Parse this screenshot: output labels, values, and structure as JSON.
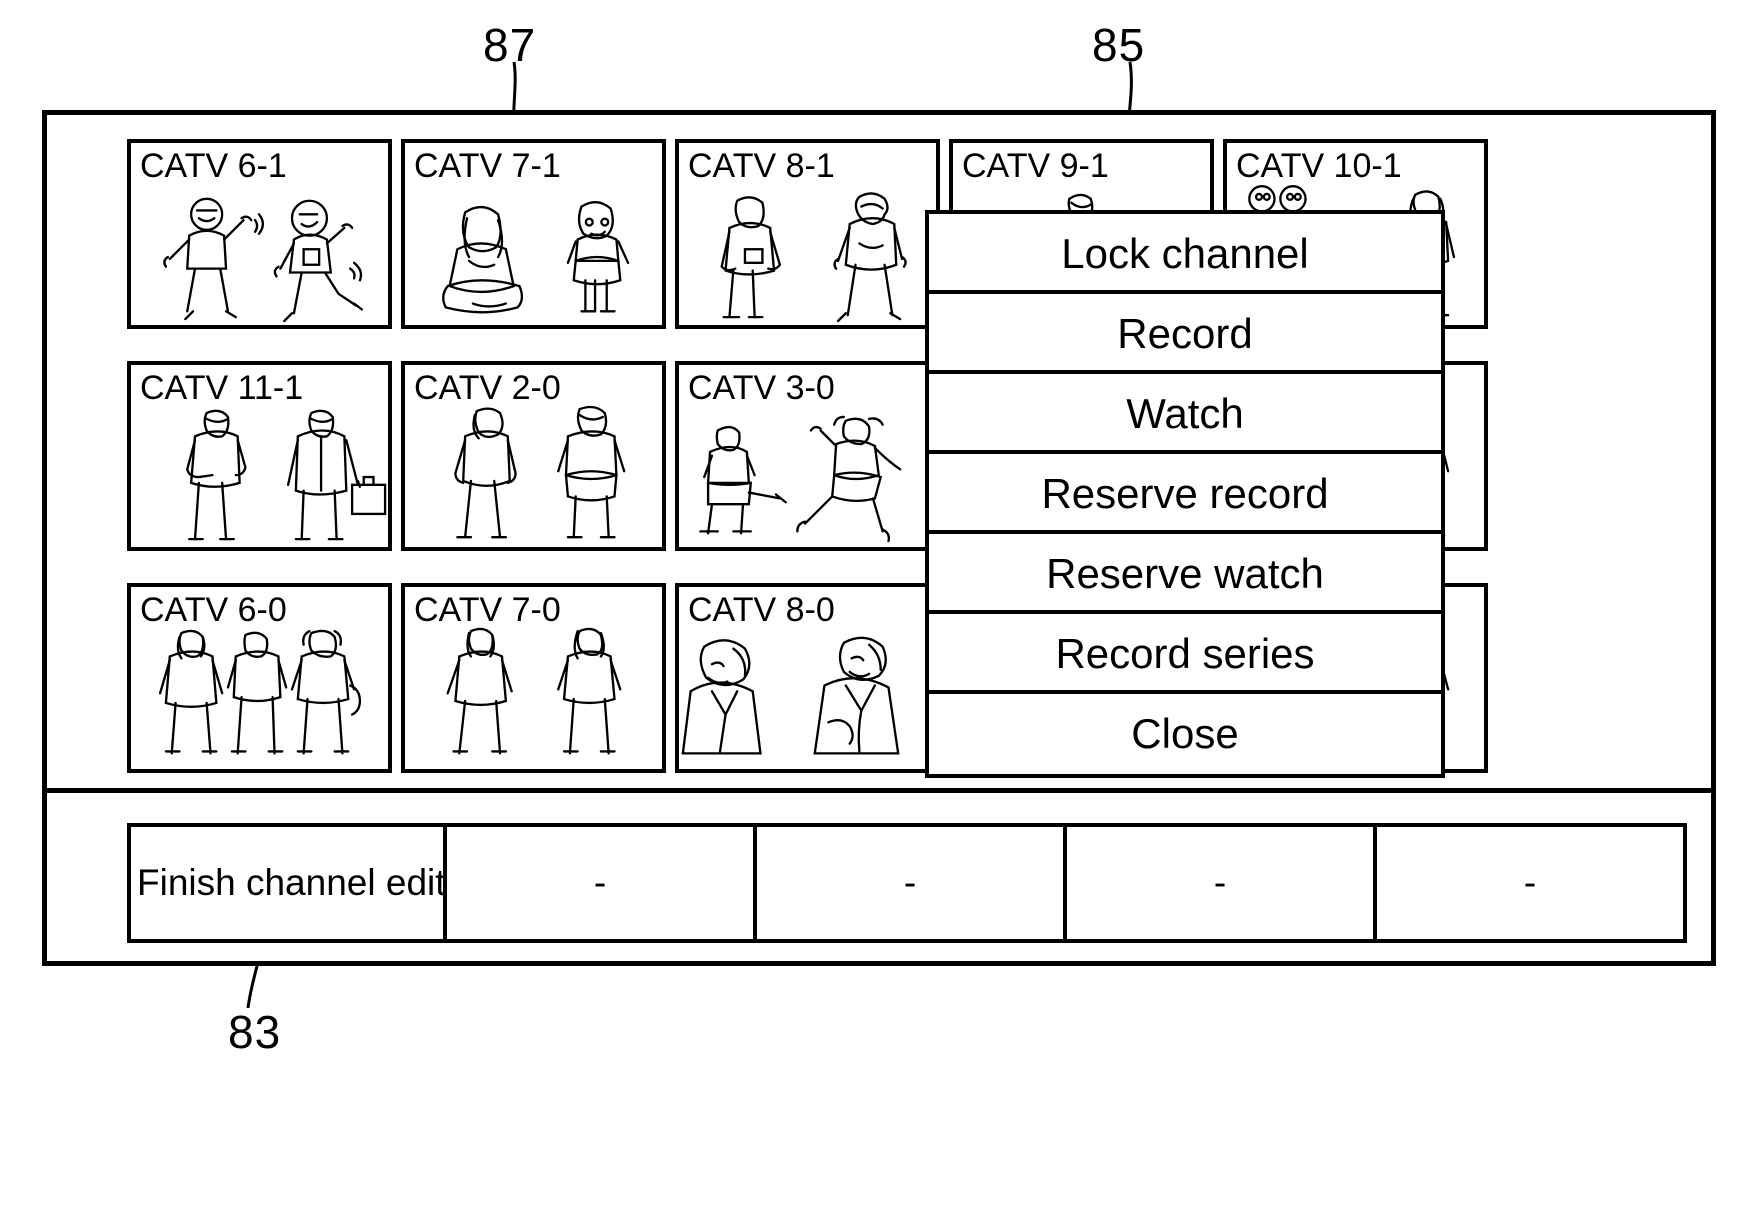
{
  "figure": {
    "reference_numerals": [
      {
        "id": "87",
        "label": "87"
      },
      {
        "id": "85",
        "label": "85"
      },
      {
        "id": "83",
        "label": "83"
      }
    ]
  },
  "grid": {
    "rows": [
      {
        "cells": [
          {
            "label": "CATV 6-1",
            "art": "two-people-dancing"
          },
          {
            "label": "CATV 7-1",
            "art": "seated-person-and-standing-girl"
          },
          {
            "label": "CATV 8-1",
            "art": "two-men-walking"
          },
          {
            "label": "CATV 9-1",
            "art": "person-partially-hidden"
          },
          {
            "label": "CATV 10-1",
            "art": "two-faces-and-person"
          }
        ]
      },
      {
        "cells": [
          {
            "label": "CATV 11-1",
            "art": "man-and-businessman-with-briefcase"
          },
          {
            "label": "CATV 2-0",
            "art": "two-people-standing"
          },
          {
            "label": "CATV 3-0",
            "art": "seated-man-and-reclining-woman"
          },
          {
            "label": "",
            "art": "hidden-behind-menu"
          },
          {
            "label": "",
            "art": "standing-person"
          }
        ]
      },
      {
        "cells": [
          {
            "label": "CATV 6-0",
            "art": "three-women-walking"
          },
          {
            "label": "CATV 7-0",
            "art": "two-women-walking"
          },
          {
            "label": "CATV 8-0",
            "art": "two-men-talking"
          },
          {
            "label": "",
            "art": "hidden-behind-menu"
          },
          {
            "label": "",
            "art": "standing-person"
          }
        ]
      }
    ]
  },
  "popup_menu": {
    "items": [
      {
        "label": "Lock channel"
      },
      {
        "label": "Record"
      },
      {
        "label": "Watch"
      },
      {
        "label": "Reserve record"
      },
      {
        "label": "Reserve watch"
      },
      {
        "label": "Record series"
      },
      {
        "label": "Close"
      }
    ]
  },
  "toolbar": {
    "buttons": [
      {
        "label": "Finish channel edit",
        "align": "left"
      },
      {
        "label": "-",
        "align": "center"
      },
      {
        "label": "-",
        "align": "center"
      },
      {
        "label": "-",
        "align": "center"
      },
      {
        "label": "-",
        "align": "center"
      }
    ]
  },
  "colors": {
    "ink": "#000000",
    "paper": "#ffffff"
  }
}
